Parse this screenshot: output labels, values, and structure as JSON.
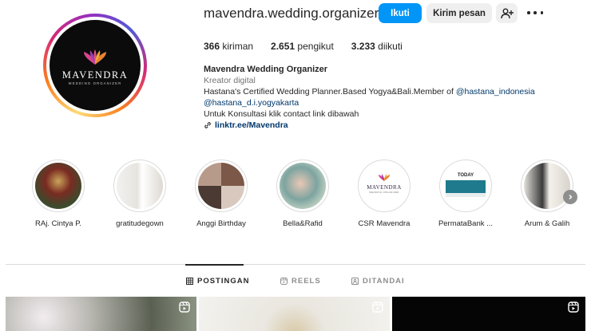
{
  "profile": {
    "username": "mavendra.wedding.organizer",
    "avatar_logo_text": "MAVENDRA",
    "avatar_logo_subtext": "WEDDING ORGANIZER",
    "follow_label": "Ikuti",
    "message_label": "Kirim pesan",
    "add_user_icon": "add-user-icon",
    "more_icon": "more-options-icon"
  },
  "stats": {
    "posts_count": "366",
    "posts_label": "kiriman",
    "followers_count": "2.651",
    "followers_label": "pengikut",
    "following_count": "3.233",
    "following_label": "diikuti"
  },
  "bio": {
    "name": "Mavendra Wedding Organizer",
    "category": "Kreator digital",
    "line1_text": "Hastana's Certified Wedding Planner.Based Yogya&Bali.Member of ",
    "line1_mention": "@hastana_indonesia",
    "line2_mention": "@hastana_d.i.yogyakarta",
    "line3": "Untuk Konsultasi klik contact link dibawah",
    "link": "linktr.ee/Mavendra"
  },
  "highlights": [
    {
      "label": "RAj. Cintya P."
    },
    {
      "label": "gratitudegown"
    },
    {
      "label": "Anggi Birthday"
    },
    {
      "label": "Bella&Rafid"
    },
    {
      "label": "CSR Mavendra",
      "logo_text": "MAVENDRA",
      "logo_sub": "WEDDING ORGANIZER"
    },
    {
      "label": "PermataBank ...",
      "tag": "TODAY"
    },
    {
      "label": "Arum & Galih"
    }
  ],
  "tabs": [
    {
      "label": "POSTINGAN",
      "icon": "grid-icon",
      "active": true
    },
    {
      "label": "REELS",
      "icon": "reels-icon",
      "active": false
    },
    {
      "label": "DITANDAI",
      "icon": "tagged-icon",
      "active": false
    }
  ],
  "colors": {
    "follow_button": "#0095f6",
    "secondary_button": "#efefef",
    "link": "#00376b"
  }
}
